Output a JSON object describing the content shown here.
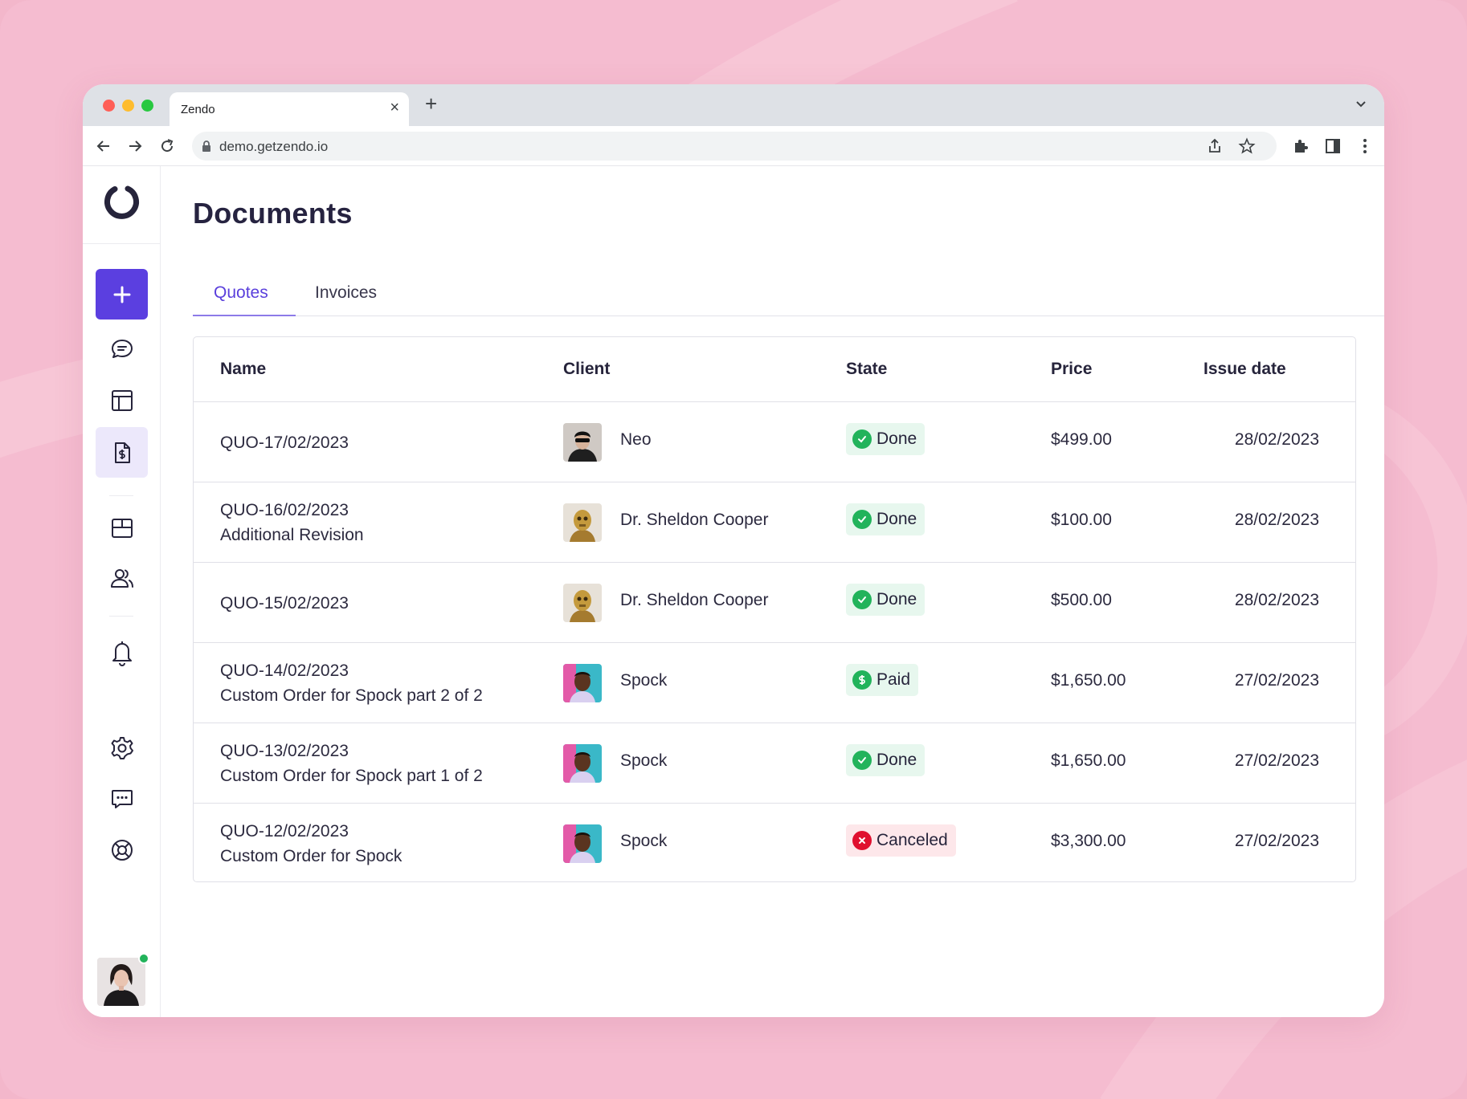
{
  "browser": {
    "tab_title": "Zendo",
    "new_tab": "+",
    "close_tab": "×",
    "url": "demo.getzendo.io"
  },
  "sidebar": {
    "items": [
      {
        "name": "create-new",
        "icon": "plus-icon"
      },
      {
        "name": "messages",
        "icon": "chat-bubble-icon"
      },
      {
        "name": "dashboard",
        "icon": "layout-icon"
      },
      {
        "name": "documents",
        "icon": "invoice-document-icon",
        "active": true
      },
      {
        "name": "inbox",
        "icon": "inbox-icon"
      },
      {
        "name": "clients",
        "icon": "users-icon"
      },
      {
        "name": "notifications",
        "icon": "bell-icon"
      },
      {
        "name": "settings",
        "icon": "gear-icon"
      },
      {
        "name": "feedback",
        "icon": "message-dots-icon"
      },
      {
        "name": "support",
        "icon": "lifebuoy-icon"
      }
    ],
    "user_status": "online"
  },
  "page": {
    "title": "Documents",
    "tabs": [
      {
        "label": "Quotes",
        "active": true
      },
      {
        "label": "Invoices",
        "active": false
      }
    ]
  },
  "table": {
    "columns": {
      "name": "Name",
      "client": "Client",
      "state": "State",
      "price": "Price",
      "issue_date": "Issue date"
    },
    "rows": [
      {
        "id": "QUO-17/02/2023",
        "subtitle": "",
        "client": "Neo",
        "state": "Done",
        "state_type": "done",
        "price": "$499.00",
        "issue_date": "28/02/2023"
      },
      {
        "id": "QUO-16/02/2023",
        "subtitle": "Additional Revision",
        "client": "Dr. Sheldon Cooper",
        "state": "Done",
        "state_type": "done",
        "price": "$100.00",
        "issue_date": "28/02/2023"
      },
      {
        "id": "QUO-15/02/2023",
        "subtitle": "",
        "client": "Dr. Sheldon Cooper",
        "state": "Done",
        "state_type": "done",
        "price": "$500.00",
        "issue_date": "28/02/2023"
      },
      {
        "id": "QUO-14/02/2023",
        "subtitle": "Custom Order for Spock part 2 of 2",
        "client": "Spock",
        "state": "Paid",
        "state_type": "paid",
        "price": "$1,650.00",
        "issue_date": "27/02/2023"
      },
      {
        "id": "QUO-13/02/2023",
        "subtitle": "Custom Order for Spock part 1 of 2",
        "client": "Spock",
        "state": "Done",
        "state_type": "done",
        "price": "$1,650.00",
        "issue_date": "27/02/2023"
      },
      {
        "id": "QUO-12/02/2023",
        "subtitle": "Custom Order for Spock",
        "client": "Spock",
        "state": "Canceled",
        "state_type": "canceled",
        "price": "$3,300.00",
        "issue_date": "27/02/2023"
      }
    ]
  },
  "colors": {
    "accent": "#5b3fe0",
    "done": "#22b35b",
    "canceled": "#e0102f",
    "background": "#f5bcd0"
  }
}
